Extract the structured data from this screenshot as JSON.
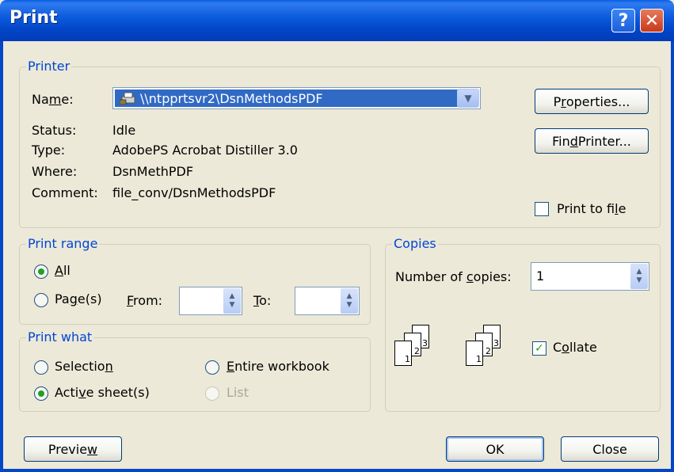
{
  "window": {
    "title": "Print"
  },
  "printer": {
    "legend": "Printer",
    "name_label_pre": "Na",
    "name_label_u": "m",
    "name_label_post": "e:",
    "name_value": "\\\\ntpprtsvr2\\DsnMethodsPDF",
    "status_label": "Status:",
    "status_value": "Idle",
    "type_label": "Type:",
    "type_value": "AdobePS Acrobat Distiller 3.0",
    "where_label": "Where:",
    "where_value": "DsnMethPDF",
    "comment_label": "Comment:",
    "comment_value": "file_conv/DsnMethodsPDF",
    "properties_pre": "P",
    "properties_u": "r",
    "properties_post": "operties...",
    "find_pre": "Fin",
    "find_u": "d",
    "find_post": " Printer...",
    "print_to_file_pre": "Print to fi",
    "print_to_file_u": "l",
    "print_to_file_post": "e",
    "print_to_file_checked": false
  },
  "print_range": {
    "legend": "Print range",
    "all_u": "A",
    "all_post": "ll",
    "pages_pre": "Pa",
    "pages_u": "g",
    "pages_post": "e(s)",
    "from_u": "F",
    "from_post": "rom:",
    "to_u": "T",
    "to_post": "o:",
    "selected": "all",
    "from_value": "",
    "to_value": ""
  },
  "print_what": {
    "legend": "Print what",
    "selection_pre": "Selectio",
    "selection_u": "n",
    "entire_u": "E",
    "entire_post": "ntire workbook",
    "active_pre": "Acti",
    "active_u": "v",
    "active_post": "e sheet(s)",
    "list_label": "List",
    "selected": "active"
  },
  "copies": {
    "legend": "Copies",
    "number_pre": "Number of ",
    "number_u": "c",
    "number_post": "opies:",
    "number_value": "1",
    "collate_pre": "C",
    "collate_u": "o",
    "collate_post": "llate",
    "collate_checked": true,
    "page_numbers": [
      "1",
      "2",
      "3"
    ]
  },
  "buttons": {
    "preview_pre": "Previe",
    "preview_u": "w",
    "ok": "OK",
    "close": "Close"
  },
  "colors": {
    "accent": "#0046d5",
    "title_bar": "#0346c8"
  }
}
